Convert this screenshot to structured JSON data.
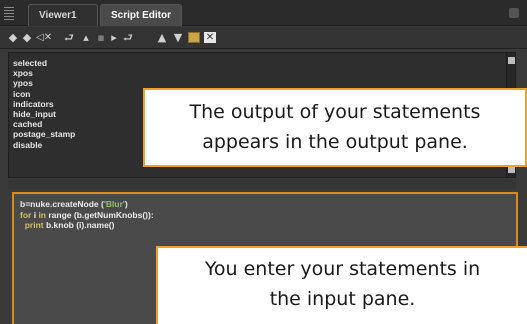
{
  "tabs": [
    {
      "label": "Viewer1"
    },
    {
      "label": "Script Editor"
    }
  ],
  "toolbar": {
    "icons": [
      "previous-script-icon",
      "next-script-icon",
      "clear-history-icon",
      "source-script-icon",
      "load-script-icon",
      "save-script-icon",
      "run-script-icon",
      "show-input-only-icon",
      "show-output-only-icon",
      "show-both-icon",
      "clear-output-icon"
    ]
  },
  "output_pane": {
    "lines": [
      "selected",
      "xpos",
      "ypos",
      "icon",
      "indicators",
      "hide_input",
      "cached",
      "postage_stamp",
      "disable"
    ]
  },
  "input_pane": {
    "line1_a": "b=nuke.createNode (",
    "line1_str": "'Blur'",
    "line1_b": ")",
    "line2_kw1": "for",
    "line2_a": " i ",
    "line2_kw2": "in",
    "line2_b": " range (b.getNumKnobs()):",
    "line3_kw": "print",
    "line3_a": " b.knob (i).name()"
  },
  "callouts": {
    "output_line1": "The output of your statements",
    "output_line2": "appears in the output pane.",
    "input_line1": "You enter your statements in",
    "input_line2": "the input pane."
  },
  "colors": {
    "callout_border": "#f0a12a",
    "input_border": "#d98a1c",
    "keyword": "#d3c06a",
    "string": "#8ec26a"
  }
}
